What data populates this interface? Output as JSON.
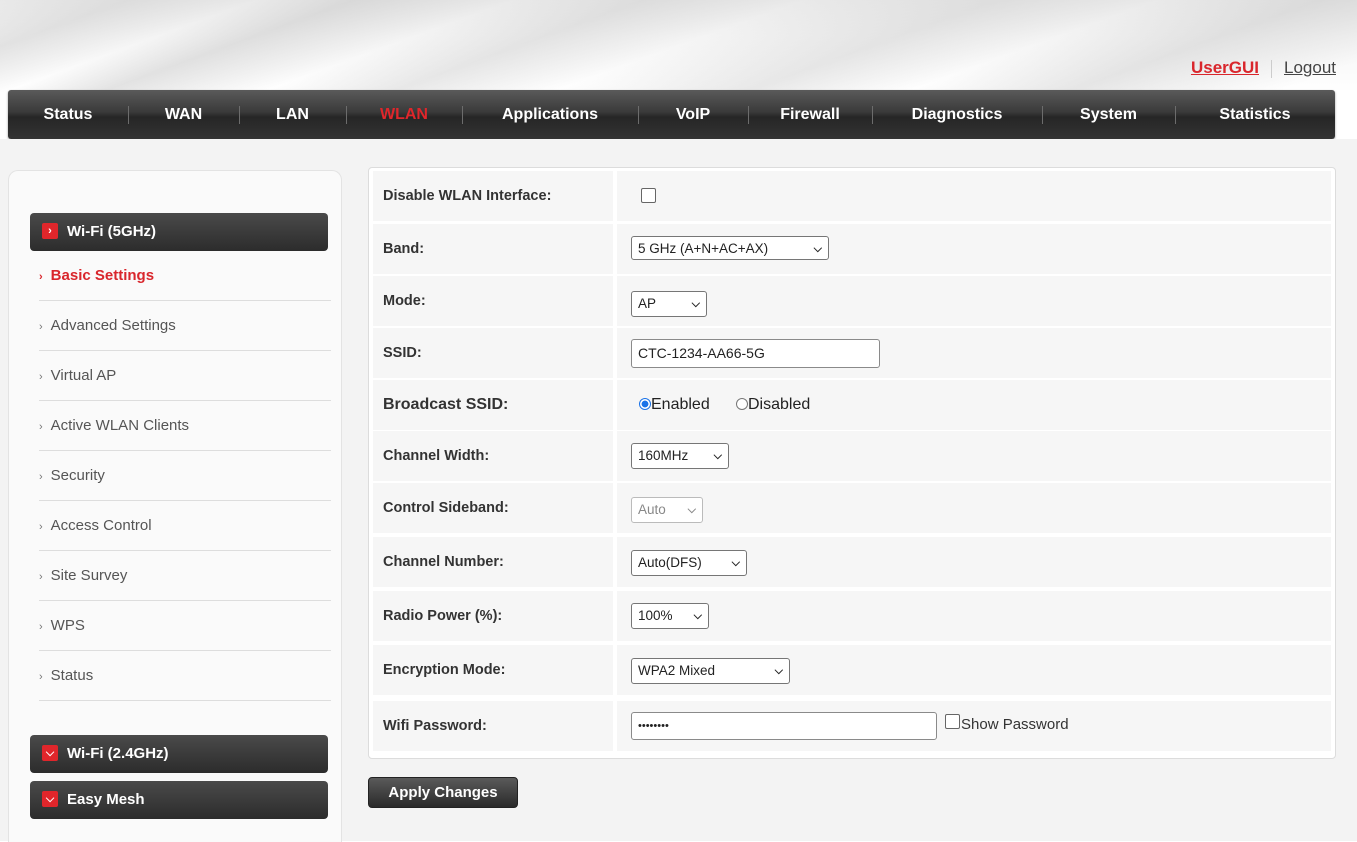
{
  "header": {
    "user_link": "UserGUI",
    "logout_link": "Logout"
  },
  "nav": {
    "items": [
      "Status",
      "WAN",
      "LAN",
      "WLAN",
      "Applications",
      "VoIP",
      "Firewall",
      "Diagnostics",
      "System",
      "Statistics"
    ],
    "active": "WLAN"
  },
  "sidebar": {
    "group_5g": "Wi-Fi (5GHz)",
    "items": [
      "Basic Settings",
      "Advanced Settings",
      "Virtual AP",
      "Active WLAN Clients",
      "Security",
      "Access Control",
      "Site Survey",
      "WPS",
      "Status"
    ],
    "active_item": "Basic Settings",
    "group_24g": "Wi-Fi (2.4GHz)",
    "group_mesh": "Easy Mesh"
  },
  "form": {
    "disable_wlan_label": "Disable WLAN Interface:",
    "disable_wlan_checked": false,
    "band_label": "Band:",
    "band_value": "5 GHz (A+N+AC+AX)",
    "mode_label": "Mode:",
    "mode_value": "AP",
    "ssid_label": "SSID:",
    "ssid_value": "CTC-1234-AA66-5G",
    "broadcast_label": "Broadcast SSID:",
    "broadcast_enabled": "Enabled",
    "broadcast_disabled": "Disabled",
    "broadcast_selected": "Enabled",
    "channel_width_label": "Channel Width:",
    "channel_width_value": "160MHz",
    "sideband_label": "Control Sideband:",
    "sideband_value": "Auto",
    "channel_number_label": "Channel Number:",
    "channel_number_value": "Auto(DFS)",
    "radio_power_label": "Radio Power (%):",
    "radio_power_value": "100%",
    "encryption_label": "Encryption Mode:",
    "encryption_value": "WPA2 Mixed",
    "password_label": "Wifi Password:",
    "password_value": "••••••••",
    "show_password_label": "Show Password"
  },
  "actions": {
    "apply_label": "Apply Changes"
  }
}
